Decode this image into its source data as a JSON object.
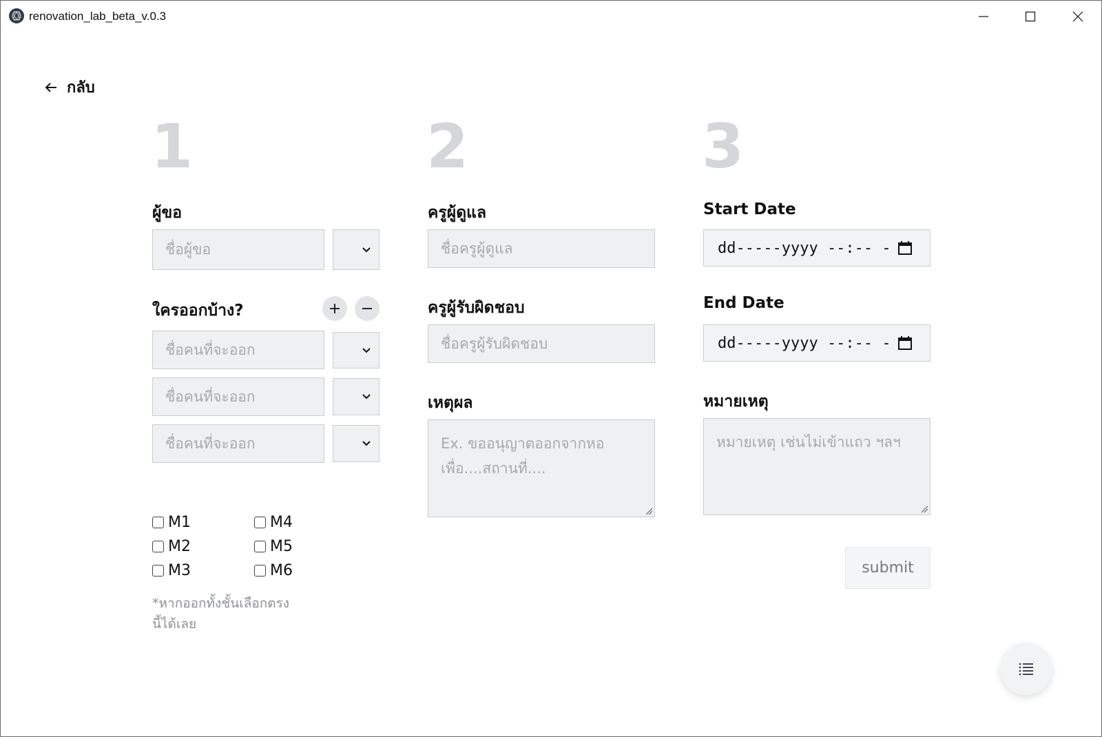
{
  "window": {
    "title": "renovation_lab_beta_v.0.3"
  },
  "nav": {
    "back_label": "กลับ"
  },
  "steps": [
    "1",
    "2",
    "3"
  ],
  "col1": {
    "requester_label": "ผู้ขอ",
    "requester_placeholder": "ชื่อผู้ขอ",
    "who_label": "ใครออกบ้าง?",
    "out_placeholder": "ชื่อคนที่จะออก",
    "classes": [
      "M1",
      "M2",
      "M3",
      "M4",
      "M5",
      "M6"
    ],
    "note": "*หากออกทั้งชั้นเลือกตรงนี้ได้เลย"
  },
  "col2": {
    "advisor_label": "ครูผู้ดูแล",
    "advisor_placeholder": "ชื่อครูผู้ดูแล",
    "responsible_label": "ครูผู้รับผิดชอบ",
    "responsible_placeholder": "ชื่อครูผู้รับผิดชอบ",
    "reason_label": "เหตุผล",
    "reason_placeholder": "Ex. ขออนุญาตออกจากหอ เพื่อ....สถานที่...."
  },
  "col3": {
    "start_label": "Start Date",
    "start_value": "dd-----yyyy --:-- -",
    "end_label": "End Date",
    "end_value": "dd-----yyyy --:-- -",
    "remark_label": "หมายเหตุ",
    "remark_placeholder": "หมายเหตุ เช่นไม่เข้าแถว ฯลฯ",
    "submit_label": "submit"
  },
  "icons": {
    "back": "arrow-left-icon",
    "dropdown": "chevron-down-icon",
    "add": "plus-icon",
    "remove": "minus-icon",
    "calendar": "calendar-icon",
    "menu": "list-icon"
  }
}
